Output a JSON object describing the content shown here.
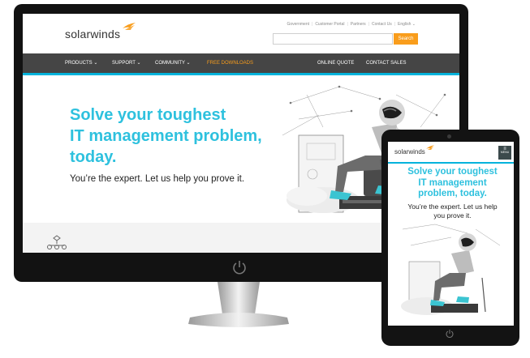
{
  "desktop": {
    "utility_links": [
      "Government",
      "Customer Portal",
      "Partners",
      "Contact Us",
      "English ⌄"
    ],
    "logo_text": "solarwinds",
    "search": {
      "placeholder": "",
      "button_label": "Search"
    },
    "nav": {
      "left": [
        "PRODUCTS ⌄",
        "SUPPORT ⌄",
        "COMMUNITY ⌄",
        "FREE DOWNLOADS"
      ],
      "right": [
        "ONLINE QUOTE",
        "CONTACT SALES"
      ]
    },
    "hero": {
      "title_lines": [
        "Solve your toughest",
        "IT management problem,",
        "today."
      ],
      "subtitle": "You’re the expert. Let us help you prove it."
    }
  },
  "tablet": {
    "logo_text": "solarwinds",
    "menu_label": "MENU",
    "hero": {
      "title_lines": [
        "Solve your toughest",
        "IT management",
        "problem, today."
      ],
      "subtitle_lines": [
        "You’re the expert. Let us help",
        "you prove it."
      ]
    }
  },
  "colors": {
    "accent": "#2ec1de",
    "orange": "#f99d1c",
    "nav_bg": "#454545",
    "device": "#121212"
  }
}
